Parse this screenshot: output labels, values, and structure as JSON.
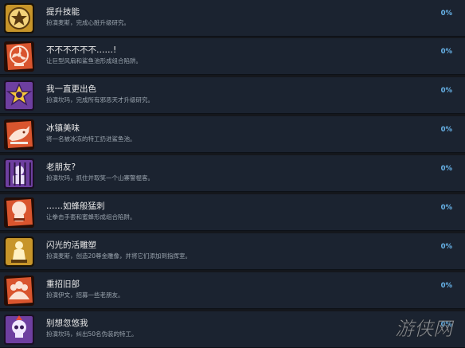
{
  "achievements": [
    {
      "name": "提升技能",
      "description": "扮演麦斯，完成心脏升级研究。",
      "progress": "0%",
      "icon": "star-medal-icon",
      "colors": {
        "bg": "#c7952a",
        "accent": "#5a3a10"
      }
    },
    {
      "name": "不不不不不不……!",
      "description": "让巨型风扇和鲨鱼池形成组合陷阱。",
      "progress": "0%",
      "icon": "fan-icon",
      "colors": {
        "bg": "#d9552e",
        "accent": "#fbe3d5"
      }
    },
    {
      "name": "我一直更出色",
      "description": "扮演坎玛，完成所有邪恶天才升级研究。",
      "progress": "0%",
      "icon": "purple-star-icon",
      "colors": {
        "bg": "#6e3fa0",
        "accent": "#f5c63a"
      }
    },
    {
      "name": "冰镇美味",
      "description": "将一名被冰冻的特工扔进鲨鱼池。",
      "progress": "0%",
      "icon": "shark-icon",
      "colors": {
        "bg": "#d9552e",
        "accent": "#fbe3d5"
      }
    },
    {
      "name": "老朋友?",
      "description": "扮演坎玛，抓住并取笑一个山寨警棍客。",
      "progress": "0%",
      "icon": "caged-agent-icon",
      "colors": {
        "bg": "#6e3fa0",
        "accent": "#e9defa"
      }
    },
    {
      "name": "……如蜂般猛刺",
      "description": "让拳击手套和蜜蜂形成组合陷阱。",
      "progress": "0%",
      "icon": "boxing-glove-icon",
      "colors": {
        "bg": "#d9552e",
        "accent": "#fbe3d5"
      }
    },
    {
      "name": "闪光的活雕塑",
      "description": "扮演麦斯，创造20尊金雕像，并将它们添加到指挥室。",
      "progress": "0%",
      "icon": "gold-statue-icon",
      "colors": {
        "bg": "#c7952a",
        "accent": "#fff1c2"
      }
    },
    {
      "name": "重招旧部",
      "description": "扮演伊文，招募一些老朋友。",
      "progress": "0%",
      "icon": "group-icon",
      "colors": {
        "bg": "#d9552e",
        "accent": "#fbe3d5"
      }
    },
    {
      "name": "别想忽悠我",
      "description": "扮演坎玛，纠出50名伪装的特工。",
      "progress": "0%",
      "icon": "skull-icon",
      "colors": {
        "bg": "#6e3fa0",
        "accent": "#f1e8ff"
      }
    }
  ],
  "watermark": "游侠网"
}
